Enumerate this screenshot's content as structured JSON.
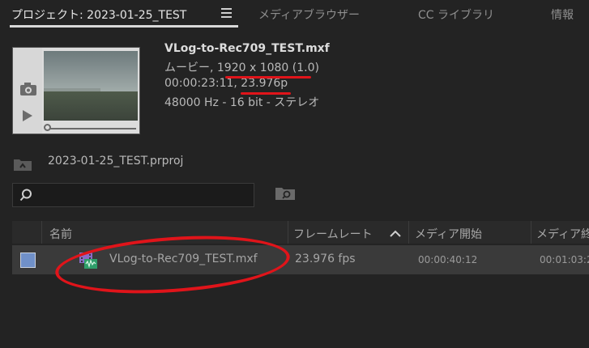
{
  "tabs": [
    {
      "label": "プロジェクト: 2023-01-25_TEST",
      "active": true
    },
    {
      "label": "メディアブラウザー",
      "active": false
    },
    {
      "label": "CC ライブラリ",
      "active": false
    },
    {
      "label": "情報",
      "active": false
    }
  ],
  "clip": {
    "name": "VLog-to-Rec709_TEST.mxf",
    "type_resolution": "ムービー, 1920 x 1080 (1.0)",
    "duration_fps": "00:00:23:11, 23.976p",
    "audio": "48000 Hz - 16 bit - ステレオ"
  },
  "project_file": "2023-01-25_TEST.prproj",
  "search": {
    "placeholder": ""
  },
  "table": {
    "columns": [
      "名前",
      "フレームレート",
      "メディア開始",
      "メディア終"
    ],
    "rows": [
      {
        "name": "VLog-to-Rec709_TEST.mxf",
        "frame_rate": "23.976 fps",
        "media_start": "00:00:40:12",
        "media_end": "00:01:03:2"
      }
    ]
  },
  "colors": {
    "annotation": "#e0141a",
    "label_swatch": "#7090c8"
  }
}
